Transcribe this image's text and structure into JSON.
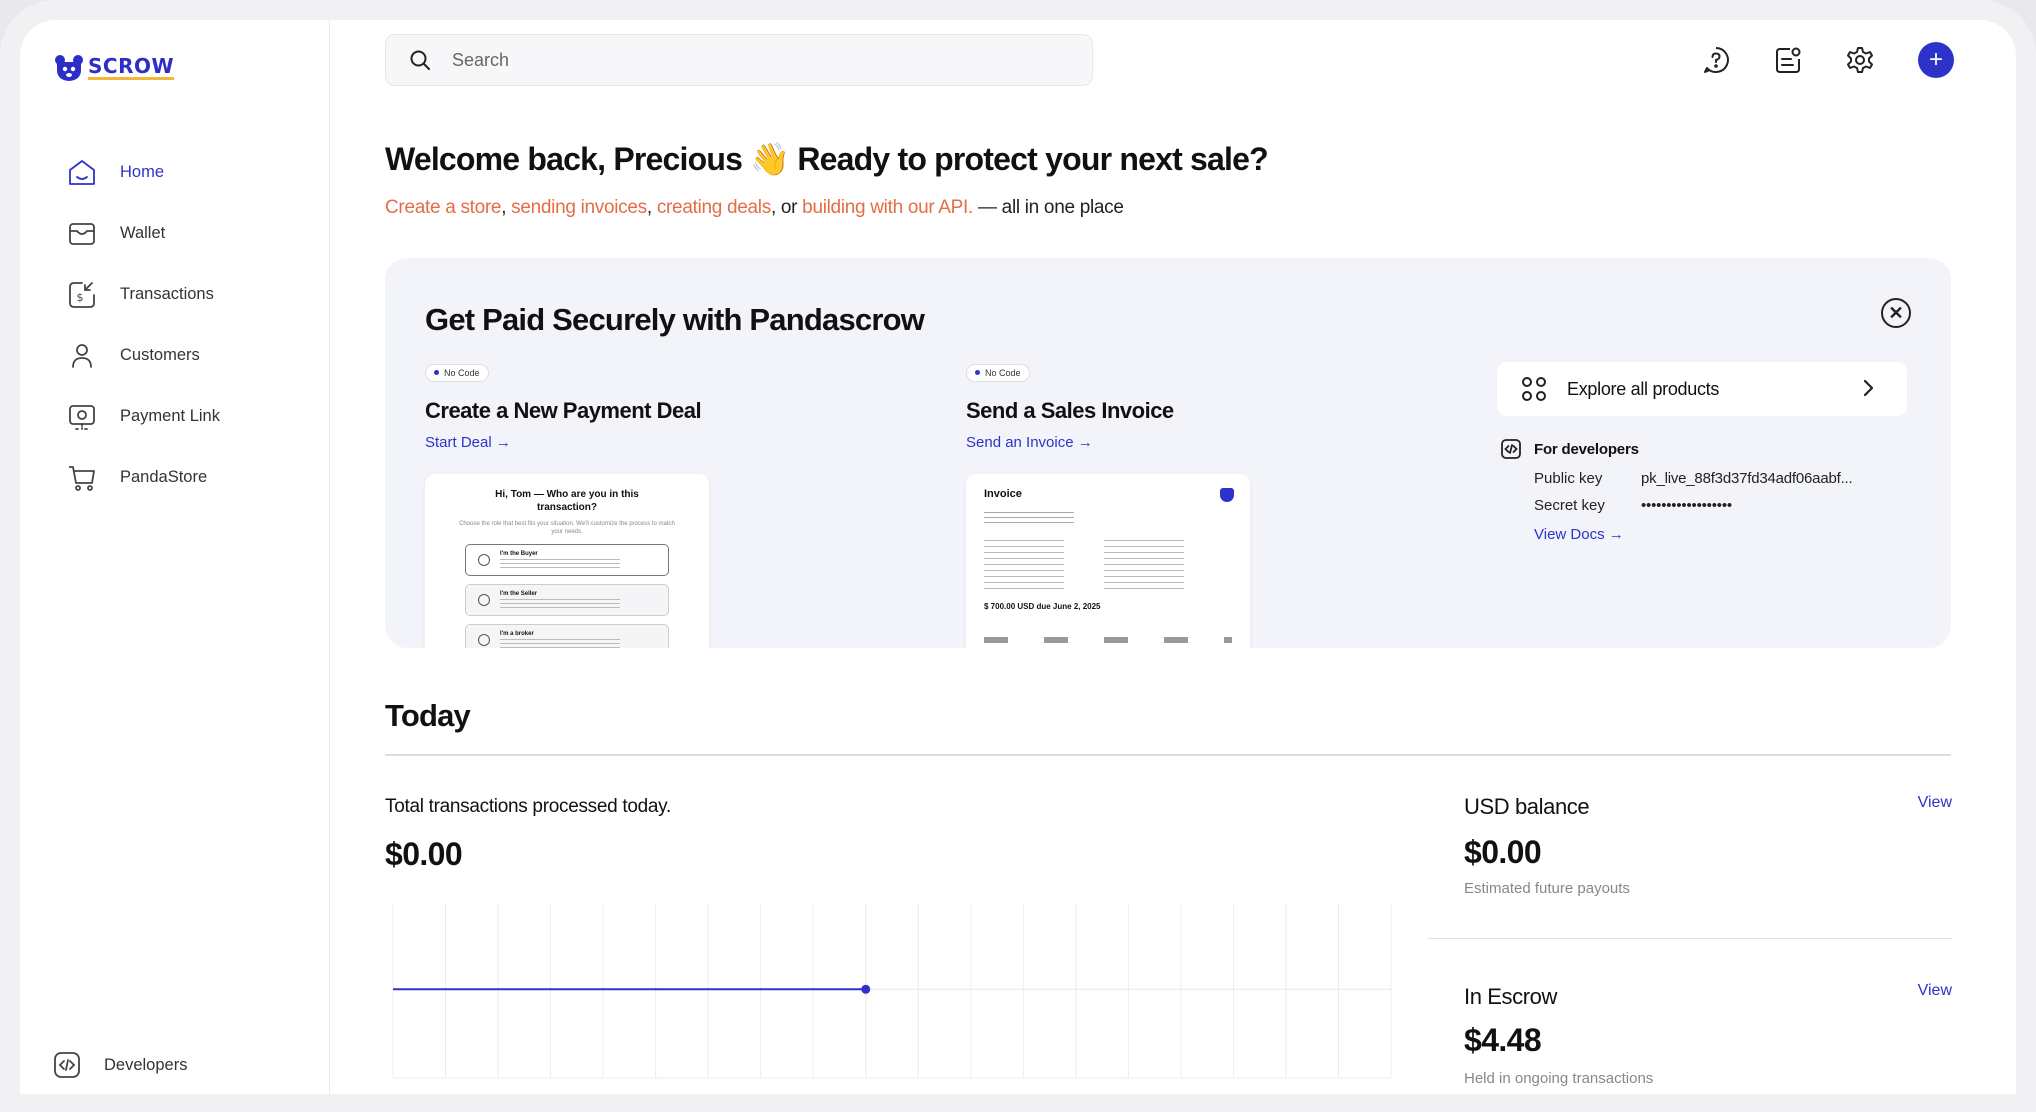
{
  "app": {
    "logo_text": "SCROW",
    "colors": {
      "accent": "#2d33c9",
      "link_orange": "#e46d45",
      "logo_underline": "#f0b73a"
    }
  },
  "sidebar": {
    "items": [
      {
        "label": "Home",
        "icon": "home-icon",
        "active": true
      },
      {
        "label": "Wallet",
        "icon": "wallet-icon",
        "active": false
      },
      {
        "label": "Transactions",
        "icon": "transactions-icon",
        "active": false
      },
      {
        "label": "Customers",
        "icon": "user-icon",
        "active": false
      },
      {
        "label": "Payment Link",
        "icon": "payment-link-icon",
        "active": false
      },
      {
        "label": "PandaStore",
        "icon": "cart-icon",
        "active": false
      }
    ],
    "developers_label": "Developers"
  },
  "search": {
    "placeholder": "Search"
  },
  "topbar": {
    "icons": [
      "help-icon",
      "notes-icon",
      "settings-icon",
      "plus-icon"
    ],
    "plus_glyph": "+"
  },
  "welcome": {
    "heading_a": "Welcome back, Precious ",
    "emoji": "👋",
    "heading_b": " Ready to protect your next sale?",
    "link1": "Create a store",
    "sep1": ", ",
    "link2": "sending invoices",
    "sep2": ", ",
    "link3": "creating deals",
    "sep3": ", or ",
    "link4": "building with our API.",
    "tail": " — all in one place"
  },
  "promo": {
    "title": "Get Paid Securely with Pandascrow",
    "close_glyph": "✕",
    "deal": {
      "badge": "No Code",
      "title": "Create a New Payment Deal",
      "link": "Start Deal →",
      "mock_title": "Hi, Tom — Who are you in this transaction?",
      "mock_sub": "Choose the role that best fits your situation. We'll customize the process to match your needs.",
      "options": [
        "I'm the Buyer",
        "I'm the Seller",
        "I'm a broker"
      ]
    },
    "invoice": {
      "badge": "No Code",
      "title": "Send a Sales Invoice",
      "link": "Send an Invoice →",
      "mock_title": "Invoice",
      "mock_due": "$ 700.00 USD due June 2, 2025"
    },
    "explore_label": "Explore all products",
    "developers": {
      "heading": "For developers",
      "public_key_label": "Public key",
      "public_key_value": "pk_live_88f3d37fd34adf06aabf...",
      "secret_key_label": "Secret key",
      "secret_key_value": "••••••••••••••••••",
      "docs_link": "View Docs →"
    }
  },
  "today": {
    "heading": "Today",
    "total_label": "Total transactions processed today.",
    "total_value": "$0.00",
    "usd": {
      "title": "USD balance",
      "value": "$0.00",
      "sub": "Estimated future payouts",
      "view": "View"
    },
    "escrow": {
      "title": "In Escrow",
      "value": "$4.48",
      "sub": "Held in ongoing transactions",
      "view": "View"
    }
  },
  "chart_data": {
    "type": "line",
    "series": [
      {
        "values": [
          0,
          0,
          0,
          0,
          0,
          0,
          0,
          0,
          0,
          0
        ]
      }
    ],
    "ylim": [
      -1,
      1
    ],
    "grid": true,
    "color": "#2d33c9"
  }
}
